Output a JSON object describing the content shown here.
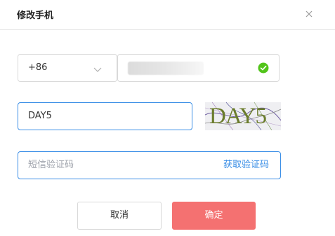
{
  "dialog": {
    "title": "修改手机",
    "close_icon": "close-icon"
  },
  "country_code": {
    "value": "+86",
    "icon": "chevron-down-icon"
  },
  "phone": {
    "value": "",
    "valid_icon": "check-circle-icon",
    "valid_color": "#52c41a"
  },
  "captcha": {
    "value": "DAY5",
    "image_text": "DAY5"
  },
  "sms_code": {
    "placeholder": "短信验证码",
    "get_code_label": "获取验证码"
  },
  "actions": {
    "cancel_label": "取消",
    "confirm_label": "确定"
  },
  "colors": {
    "accent": "#3a8ee6",
    "confirm": "#f47171"
  }
}
